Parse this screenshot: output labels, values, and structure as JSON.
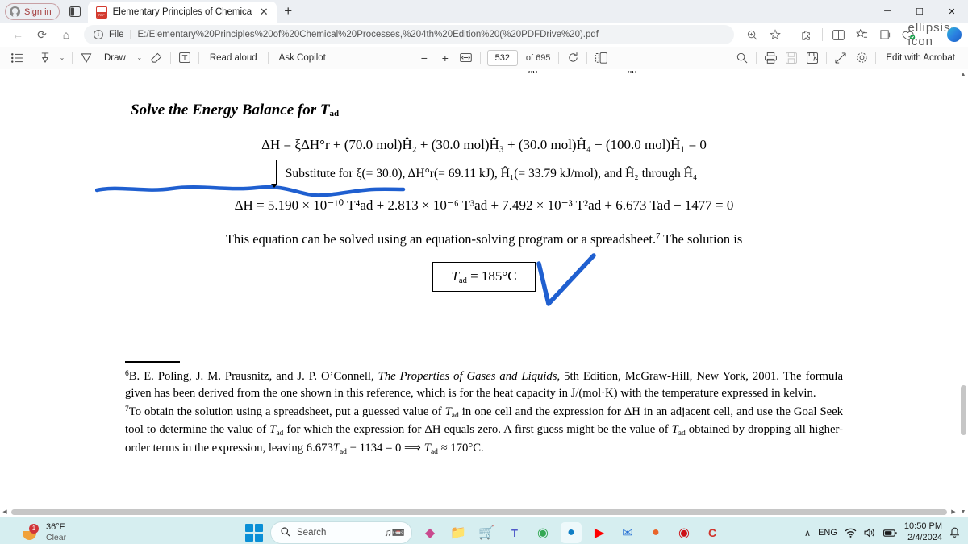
{
  "browser": {
    "signin_label": "Sign in",
    "tab": {
      "title": "Elementary Principles of Chemica",
      "favicon": "pdf-file-icon",
      "close": "✕"
    },
    "newtab_label": "+",
    "window_controls": {
      "minimize": "─",
      "maximize": "☐",
      "close": "✕"
    },
    "nav": {
      "back": "←",
      "refresh": "⟳",
      "home": "⌂",
      "scheme_label": "File",
      "separator": "|",
      "url": "E:/Elementary%20Principles%20of%20Chemical%20Processes,%204th%20Edition%20(%20PDFDrive%20).pdf",
      "zoom_icon": "magnifier-plus-icon",
      "favorite_icon": "star-icon",
      "extensions_icon": "puzzle-icon",
      "split_icon": "split-screen-icon",
      "collections_icon": "collections-icon",
      "favorites_bar_icon": "browser-essentials-icon",
      "settings_icon": "ellipsis-icon",
      "copilot_icon": "copilot-orb-icon"
    }
  },
  "pdf_toolbar": {
    "toc_icon": "table-of-contents-icon",
    "highlight_icon": "highlighter-icon",
    "highlight_caret": "⌄",
    "draw_icon": "draw-pen-icon",
    "draw_label": "Draw",
    "draw_caret": "⌄",
    "erase_icon": "eraser-icon",
    "text_icon": "add-text-icon",
    "read_aloud_label": "Read aloud",
    "ask_copilot_label": "Ask Copilot",
    "zoom_out": "−",
    "zoom_in": "+",
    "fit_page_icon": "fit-to-width-icon",
    "page_number": "532",
    "page_total_label": "of 695",
    "rotate_icon": "rotate-icon",
    "layout_icon": "page-view-icon",
    "search_icon": "search-icon",
    "print_icon": "print-icon",
    "save_icon": "save-icon",
    "save_as_icon": "save-as-icon",
    "fullscreen_icon": "fullscreen-icon",
    "settings_icon": "gear-icon",
    "edit_with_acrobat_label": "Edit with Acrobat"
  },
  "document": {
    "clipped_top_left": "ad",
    "clipped_top_right": "ad",
    "heading_text": "Solve the Energy Balance for ",
    "heading_sub": "ad",
    "heading_var": "T",
    "equation_1": "ΔH = ξΔH°r + (70.0 mol)Ĥ₂ + (30.0 mol)Ĥ₃ + (30.0 mol)Ĥ₄ − (100.0 mol)Ĥ₁ = 0",
    "substitute_text": "Substitute for ξ(= 30.0), ΔH°r(= 69.11 kJ), Ĥ₁(= 33.79 kJ/mol), and Ĥ₂ through Ĥ₄",
    "equation_2": "ΔH = 5.190 × 10⁻¹⁰ T⁴ad + 2.813 × 10⁻⁶ T³ad + 7.492 × 10⁻³ T²ad + 6.673 Tad − 1477 = 0",
    "solution_sentence": "This equation can be solved using an equation-solving program or a spreadsheet.",
    "solution_sentence_footnote": "7",
    "solution_sentence_tail": " The solution is",
    "answer_box": "Tₐd = 185°C",
    "answer_var": "T",
    "answer_sub": "ad",
    "answer_value": " = 185°C",
    "annotation_color": "#1f5fd0",
    "footnote_6_marker": "6",
    "footnote_6_part1": "B. E. Poling, J. M. Prausnitz, and J. P. O’Connell, ",
    "footnote_6_italic": "The Properties of Gases and Liquids",
    "footnote_6_part2": ", 5th Edition, McGraw-Hill, New York, 2001. The formula given has been derived from the one shown in this reference, which is for the heat capacity in J/(mol·K) with the temperature expressed in kelvin.",
    "footnote_7_marker": "7",
    "footnote_7_a": "To obtain the solution using a spreadsheet, put a guessed value of ",
    "footnote_7_b": " in one cell and the expression for ΔH in an adjacent cell, and use the Goal Seek tool to determine the value of ",
    "footnote_7_c": " for which the expression for ΔH equals zero. A first guess might be the value of ",
    "footnote_7_d": " obtained by dropping all higher-order terms in the expression, leaving ",
    "footnote_7_e": "6.673",
    "footnote_7_f": " − 1134 = 0 ⟹ ",
    "footnote_7_g": " ≈ 170°C.",
    "tad_var": "T",
    "tad_sub": "ad"
  },
  "scrollbars": {
    "up_arrow": "▲",
    "down_arrow": "▼",
    "left_arrow": "◀",
    "right_arrow": "▶"
  },
  "taskbar": {
    "weather_temp": "36°F",
    "weather_cond": "Clear",
    "weather_badge": "1",
    "start_label": "windows-start-icon",
    "search_placeholder": "Search",
    "apps": [
      {
        "name": "office-icon",
        "glyph": "◆",
        "color": "#c94a8e",
        "active": false
      },
      {
        "name": "file-explorer-icon",
        "glyph": "▬",
        "color": "#f2c14b",
        "active": false
      },
      {
        "name": "microsoft-store-icon",
        "glyph": "■",
        "color": "#1f4e79",
        "active": false
      },
      {
        "name": "microsoft-teams-icon",
        "glyph": "T",
        "color": "#5059c9",
        "active": false
      },
      {
        "name": "google-chrome-icon",
        "glyph": "●",
        "color": "#34a853",
        "active": false
      },
      {
        "name": "microsoft-edge-icon",
        "glyph": "●",
        "color": "#0f7ec5",
        "active": true
      },
      {
        "name": "youtube-icon",
        "glyph": "▶",
        "color": "#ff0000",
        "active": false
      },
      {
        "name": "mail-icon",
        "glyph": "✉",
        "color": "#2a72d4",
        "active": false
      },
      {
        "name": "firefox-icon",
        "glyph": "●",
        "color": "#e9642a",
        "active": false
      },
      {
        "name": "opera-icon",
        "glyph": "●",
        "color": "#cc0f16",
        "active": false
      },
      {
        "name": "ccleaner-icon",
        "glyph": "C",
        "color": "#d0342c",
        "active": false
      }
    ],
    "tray": {
      "chevron": "∧",
      "language": "ENG",
      "wifi_icon": "wifi-icon",
      "volume_icon": "speaker-icon",
      "battery_icon": "battery-icon",
      "time": "10:50 PM",
      "date": "2/4/2024",
      "notification_icon": "bell-icon"
    }
  }
}
